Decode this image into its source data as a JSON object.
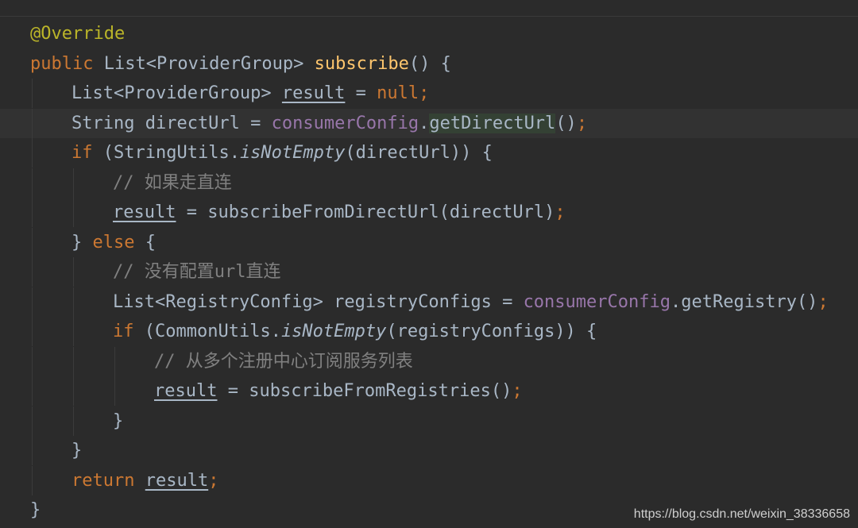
{
  "editor": {
    "colors": {
      "background": "#2b2b2b",
      "current_line": "#323232",
      "default": "#a9b7c6",
      "keyword": "#cc7832",
      "annotation": "#bbb529",
      "method_declaration": "#ffc66d",
      "field": "#9876aa",
      "comment": "#808080",
      "usage_highlight": "#344134"
    },
    "lines": [
      {
        "tokens": [
          {
            "t": "@Override",
            "c": "ann"
          }
        ]
      },
      {
        "tokens": [
          {
            "t": "public ",
            "c": "kw"
          },
          {
            "t": "List<ProviderGroup> "
          },
          {
            "t": "subscribe",
            "c": "fn"
          },
          {
            "t": "() {"
          }
        ]
      },
      {
        "tokens": [
          {
            "t": "List<ProviderGroup> "
          },
          {
            "t": "result",
            "c": "ul"
          },
          {
            "t": " = "
          },
          {
            "t": "null",
            "c": "kw"
          },
          {
            "t": ";",
            "c": "kw"
          }
        ]
      },
      {
        "current": true,
        "tokens": [
          {
            "t": "String directUrl = "
          },
          {
            "t": "consumerConfig",
            "c": "field"
          },
          {
            "t": "."
          },
          {
            "t": "getDirectUrl",
            "c": "usage"
          },
          {
            "t": "()"
          },
          {
            "t": ";",
            "c": "kw"
          }
        ]
      },
      {
        "tokens": [
          {
            "t": "if ",
            "c": "kw"
          },
          {
            "t": "(StringUtils."
          },
          {
            "t": "isNotEmpty",
            "c": "it"
          },
          {
            "t": "(directUrl)) {"
          }
        ]
      },
      {
        "tokens": [
          {
            "t": "// 如果走直连",
            "c": "cmt"
          }
        ]
      },
      {
        "tokens": [
          {
            "t": "result",
            "c": "ul"
          },
          {
            "t": " = subscribeFromDirectUrl(directUrl)"
          },
          {
            "t": ";",
            "c": "kw"
          }
        ]
      },
      {
        "tokens": [
          {
            "t": "} "
          },
          {
            "t": "else ",
            "c": "kw"
          },
          {
            "t": "{"
          }
        ]
      },
      {
        "tokens": [
          {
            "t": "// 没有配置url直连",
            "c": "cmt"
          }
        ]
      },
      {
        "tokens": [
          {
            "t": "List<RegistryConfig> registryConfigs = "
          },
          {
            "t": "consumerConfig",
            "c": "field"
          },
          {
            "t": ".getRegistry()"
          },
          {
            "t": ";",
            "c": "kw"
          }
        ]
      },
      {
        "tokens": [
          {
            "t": "if ",
            "c": "kw"
          },
          {
            "t": "(CommonUtils."
          },
          {
            "t": "isNotEmpty",
            "c": "it"
          },
          {
            "t": "(registryConfigs)) {"
          }
        ]
      },
      {
        "tokens": [
          {
            "t": "// 从多个注册中心订阅服务列表",
            "c": "cmt"
          }
        ]
      },
      {
        "tokens": [
          {
            "t": "result",
            "c": "ul"
          },
          {
            "t": " = subscribeFromRegistries()"
          },
          {
            "t": ";",
            "c": "kw"
          }
        ]
      },
      {
        "tokens": [
          {
            "t": "}"
          }
        ]
      },
      {
        "tokens": [
          {
            "t": "}"
          }
        ]
      },
      {
        "tokens": [
          {
            "t": "return ",
            "c": "kw"
          },
          {
            "t": "result",
            "c": "ul"
          },
          {
            "t": ";",
            "c": "kw"
          }
        ]
      },
      {
        "tokens": [
          {
            "t": "}"
          }
        ]
      }
    ]
  },
  "watermark": "https://blog.csdn.net/weixin_38336658"
}
